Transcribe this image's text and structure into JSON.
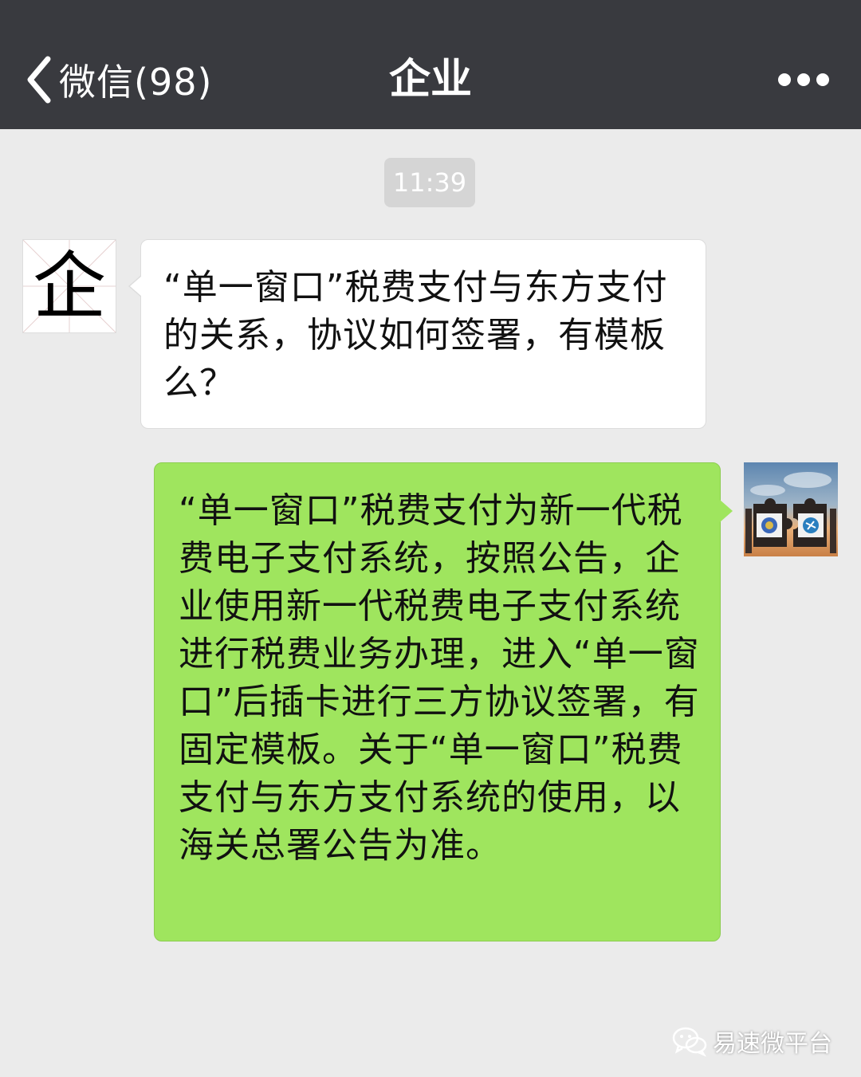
{
  "navbar": {
    "back_label": "微信(98)",
    "title": "企业",
    "back_icon": "chevron-left-icon",
    "more_icon": "more-dots-icon"
  },
  "chat": {
    "timestamp": "11:39",
    "messages": [
      {
        "side": "left",
        "avatar_text": "企",
        "text": "“单一窗口”税费支付与东方支付的关系，协议如何签署，有模板么？"
      },
      {
        "side": "right",
        "text": "“单一窗口”税费支付为新一代税费电子支付系统，按照公告，企业使用新一代税费电子支付系统进行税费业务办理，进入“单一窗口”后插卡进行三方协议签署，有固定模板。关于“单一窗口”税费支付与东方支付系统的使用，以海关总署公告为准。"
      }
    ]
  },
  "watermark": {
    "text": "易速微平台",
    "icon": "wechat-icon"
  },
  "colors": {
    "navbar": "#393a3f",
    "background": "#ebebeb",
    "sent_bubble": "#9fe55e",
    "received_bubble": "#ffffff"
  }
}
